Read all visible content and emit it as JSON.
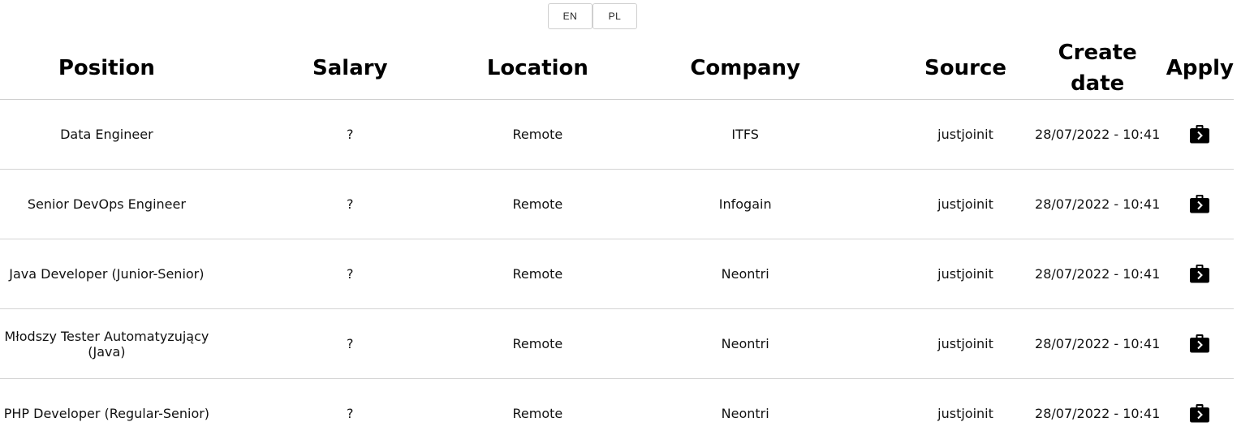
{
  "language_switch": {
    "en_label": "EN",
    "pl_label": "PL"
  },
  "table": {
    "headers": {
      "position": "Position",
      "salary": "Salary",
      "location": "Location",
      "company": "Company",
      "source": "Source",
      "create_date": "Create date",
      "apply": "Apply"
    },
    "rows": [
      {
        "position": "Data Engineer",
        "salary": "?",
        "location": "Remote",
        "company": "ITFS",
        "source": "justjoinit",
        "create_date": "28/07/2022 - 10:41",
        "apply_icon": "briefcase-arrow-icon"
      },
      {
        "position": "Senior DevOps Engineer",
        "salary": "?",
        "location": "Remote",
        "company": "Infogain",
        "source": "justjoinit",
        "create_date": "28/07/2022 - 10:41",
        "apply_icon": "briefcase-arrow-icon"
      },
      {
        "position": "Java Developer (Junior-Senior)",
        "salary": "?",
        "location": "Remote",
        "company": "Neontri",
        "source": "justjoinit",
        "create_date": "28/07/2022 - 10:41",
        "apply_icon": "briefcase-arrow-icon"
      },
      {
        "position": "Młodszy Tester Automatyzujący (Java)",
        "salary": "?",
        "location": "Remote",
        "company": "Neontri",
        "source": "justjoinit",
        "create_date": "28/07/2022 - 10:41",
        "apply_icon": "briefcase-arrow-icon"
      },
      {
        "position": "PHP Developer (Regular-Senior)",
        "salary": "?",
        "location": "Remote",
        "company": "Neontri",
        "source": "justjoinit",
        "create_date": "28/07/2022 - 10:41",
        "apply_icon": "briefcase-arrow-icon"
      }
    ]
  }
}
